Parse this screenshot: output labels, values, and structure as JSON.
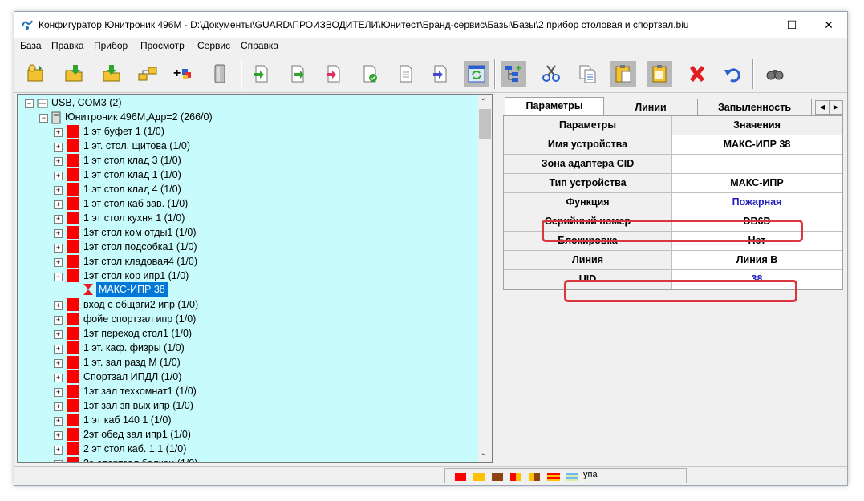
{
  "window": {
    "title": "Конфигуратор Юнитроник 496М - D:\\Документы\\GUARD\\ПРОИЗВОДИТЕЛИ\\Юнитест\\Бранд-сервис\\Базы\\Базы\\2 прибор столовая и спортзал.biu",
    "minimize": "—",
    "maximize": "☐",
    "close": "✕"
  },
  "menu": [
    "База",
    "Правка",
    "Прибор",
    "Просмотр",
    "Сервис",
    "Справка"
  ],
  "toolbar": {
    "buttons": [
      "open-icon",
      "folder-open-icon",
      "download-icon",
      "network-icon",
      "add-device-icon",
      "device-icon",
      "export-icon",
      "import-icon",
      "send-icon",
      "check-icon",
      "document-icon",
      "compare-icon",
      "refresh-icon",
      "tree-add-icon",
      "cut-icon",
      "copy-icon",
      "paste-icon",
      "paste-special-icon",
      "delete-icon",
      "undo-icon",
      "binoculars-icon"
    ]
  },
  "tree": {
    "root": "USB, COM3 (2)",
    "device": "Юнитроник 496М,Адр=2 (266/0)",
    "zones": [
      "1 эт буфет 1 (1/0)",
      "1 эт.  стол. щитова (1/0)",
      "1 эт стол клад 3 (1/0)",
      "1 эт стол клад 1 (1/0)",
      "1 эт стол клад 4 (1/0)",
      "1 эт стол каб зав. (1/0)",
      "1 эт стол кухня 1 (1/0)",
      "1эт стол ком отды1 (1/0)",
      "1эт стол подсобка1 (1/0)",
      "1эт стол кладовая4 (1/0)",
      "1эт стол кор ипр1 (1/0)"
    ],
    "selected_child": "МАКС-ИПР   38",
    "zones_after": [
      "вход с общаги2 ипр   (1/0)",
      "фойе спортзал ипр    (1/0)",
      "1эт переход стол1 (1/0)",
      "1 эт.  каф. физры (1/0)",
      "1 эт. зал разд М (1/0)",
      "Спортзал ИПДЛ (1/0)",
      "1эт зал техкомнат1 (1/0)",
      "1эт зал зп вых ипр (1/0)",
      "1 эт каб 140 1 (1/0)",
      "2эт обед зал ипр1 (1/0)",
      "2 эт стол каб.  1.1 (1/0)",
      "2э спортзал балкон   (1/0)"
    ]
  },
  "tabs": [
    "Параметры",
    "Линии",
    "Запыленность"
  ],
  "grid": {
    "header": {
      "name": "Параметры",
      "value": "Значения"
    },
    "rows": [
      {
        "name": "Имя устройства",
        "value": "МАКС-ИПР   38"
      },
      {
        "name": "Зона адаптера CID",
        "value": ""
      },
      {
        "name": "Тип устройства",
        "value": "МАКС-ИПР"
      },
      {
        "name": "Функция",
        "value": "Пожарная"
      },
      {
        "name": "Серийный номер",
        "value": "DB6D"
      },
      {
        "name": "Блокировка",
        "value": "Нет"
      },
      {
        "name": "Линия",
        "value": "Линия В"
      },
      {
        "name": "UID",
        "value": "38"
      }
    ]
  },
  "colors": {
    "tree_bg": "#c8fbfb",
    "zone_marker": "#ff0000",
    "link_value": "#1f1fbf",
    "highlight": "#d9363e",
    "selection": "#0078d7"
  },
  "status": {
    "legend_label": "упа"
  }
}
